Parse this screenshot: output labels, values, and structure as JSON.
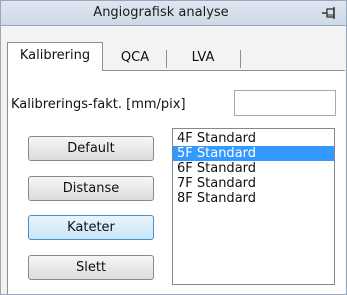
{
  "window": {
    "title": "Angiografisk analyse",
    "pin_icon": "pin-icon"
  },
  "tabs": [
    {
      "label": "Kalibrering",
      "active": true
    },
    {
      "label": "QCA",
      "active": false
    },
    {
      "label": "LVA",
      "active": false
    }
  ],
  "calibration": {
    "factor_label": "Kalibrerings-fakt. [mm/pix]",
    "factor_value": ""
  },
  "buttons": {
    "default_label": "Default",
    "distance_label": "Distanse",
    "catheter_label": "Kateter",
    "delete_label": "Slett",
    "selected": "Kateter"
  },
  "catheter_list": {
    "items": [
      "4F Standard",
      "5F Standard",
      "6F Standard",
      "7F Standard",
      "8F Standard"
    ],
    "selected_index": 1
  },
  "colors": {
    "selection": "#3399ff",
    "selected_button": "#c9e5f8",
    "titlebar": "#dfe6f1"
  }
}
